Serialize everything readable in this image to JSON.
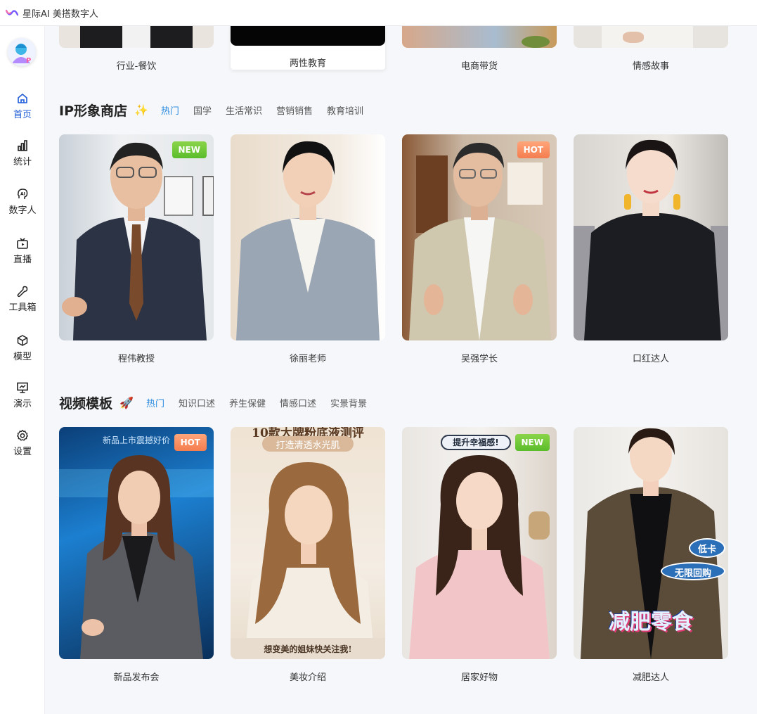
{
  "app": {
    "title": "星际AI 美搭数字人"
  },
  "sidebar": {
    "items": [
      {
        "label": "首页",
        "icon": "home-icon",
        "active": true
      },
      {
        "label": "统计",
        "icon": "bar-chart-icon"
      },
      {
        "label": "数字人",
        "icon": "ai-head-icon"
      },
      {
        "label": "直播",
        "icon": "tv-icon"
      },
      {
        "label": "工具箱",
        "icon": "wrench-icon"
      },
      {
        "label": "模型",
        "icon": "cube-icon"
      },
      {
        "label": "演示",
        "icon": "presentation-icon"
      },
      {
        "label": "设置",
        "icon": "gear-icon"
      }
    ]
  },
  "top_row": {
    "items": [
      {
        "label": "行业-餐饮"
      },
      {
        "label": "两性教育"
      },
      {
        "label": "电商带货"
      },
      {
        "label": "情感故事"
      }
    ]
  },
  "ip_store": {
    "title": "IP形象商店",
    "emoji": "✨",
    "tabs": [
      "热门",
      "国学",
      "生活常识",
      "营销销售",
      "教育培训"
    ],
    "active_tab": "热门",
    "items": [
      {
        "label": "程伟教授",
        "badge": "NEW"
      },
      {
        "label": "徐丽老师",
        "badge": ""
      },
      {
        "label": "吴强学长",
        "badge": "HOT"
      },
      {
        "label": "口红达人",
        "badge": ""
      }
    ]
  },
  "video_templates": {
    "title": "视频模板",
    "emoji": "🚀",
    "tabs": [
      "热门",
      "知识口述",
      "养生保健",
      "情感口述",
      "实景背景"
    ],
    "active_tab": "热门",
    "items": [
      {
        "label": "新品发布会",
        "badge": "HOT",
        "overlay": [
          "新品上市震撼好价"
        ]
      },
      {
        "label": "美妆介绍",
        "badge": "",
        "overlay": [
          "10款大牌粉底液测评",
          "打造清透水光肌",
          "想变美的姐妹快关注我!"
        ]
      },
      {
        "label": "居家好物",
        "badge": "NEW",
        "overlay": [
          "提升幸福感!"
        ]
      },
      {
        "label": "减肥达人",
        "badge": "",
        "overlay": [
          "低卡",
          "无限回购",
          "减肥零食"
        ]
      }
    ]
  },
  "colors": {
    "accent": "#1e5bd8",
    "tab_active": "#2a8be0",
    "badge_new": "#6cc636",
    "badge_hot": "#f58b5e"
  }
}
